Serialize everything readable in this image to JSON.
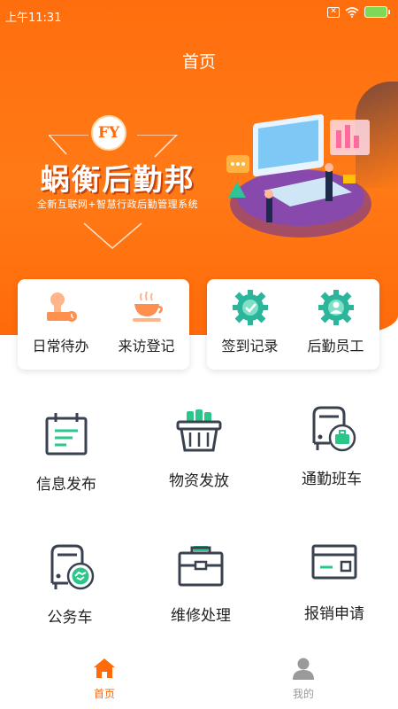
{
  "status": {
    "time": "上午11:31"
  },
  "header": {
    "title": "首页"
  },
  "banner": {
    "logo_text": "FY",
    "brand_name": "蜗衡后勤邦",
    "subtitle": "全新互联网+智慧行政后勤管理系统"
  },
  "quick_actions": [
    {
      "label": "日常待办",
      "icon": "stamp-icon"
    },
    {
      "label": "来访登记",
      "icon": "tea-cup-icon"
    },
    {
      "label": "签到记录",
      "icon": "gear-check-icon"
    },
    {
      "label": "后勤员工",
      "icon": "gear-person-icon"
    }
  ],
  "grid": [
    {
      "label": "信息发布",
      "icon": "calendar-note-icon"
    },
    {
      "label": "物资发放",
      "icon": "basket-icon"
    },
    {
      "label": "通勤班车",
      "icon": "bus-briefcase-icon"
    },
    {
      "label": "公务车",
      "icon": "car-handshake-icon"
    },
    {
      "label": "维修处理",
      "icon": "toolbox-icon"
    },
    {
      "label": "报销申请",
      "icon": "card-icon"
    }
  ],
  "nav": {
    "home": "首页",
    "mine": "我的"
  },
  "colors": {
    "accent": "#ff6a0a",
    "teal": "#2bb59a",
    "icon_dark": "#3a4250",
    "icon_green": "#2cc58a"
  }
}
